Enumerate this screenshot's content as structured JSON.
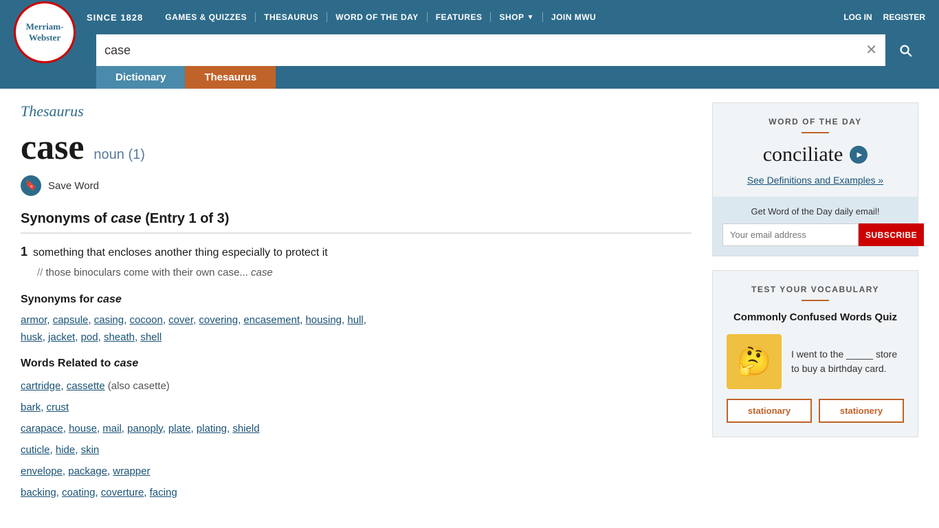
{
  "site": {
    "title": "Merriam-Webster",
    "since": "SINCE 1828",
    "logo_line1": "Merriam-",
    "logo_line2": "Webster"
  },
  "nav": {
    "items": [
      {
        "label": "GAMES & QUIZZES",
        "id": "games-quizzes"
      },
      {
        "label": "THESAURUS",
        "id": "thesaurus"
      },
      {
        "label": "WORD OF THE DAY",
        "id": "word-of-the-day"
      },
      {
        "label": "FEATURES",
        "id": "features"
      },
      {
        "label": "SHOP",
        "id": "shop",
        "has_dropdown": true
      },
      {
        "label": "JOIN MWU",
        "id": "join-mwu"
      }
    ],
    "auth": [
      {
        "label": "LOG IN",
        "id": "login"
      },
      {
        "label": "REGISTER",
        "id": "register"
      }
    ]
  },
  "search": {
    "value": "case",
    "placeholder": "Search"
  },
  "tabs": [
    {
      "label": "Dictionary",
      "id": "dictionary",
      "active": false
    },
    {
      "label": "Thesaurus",
      "id": "thesaurus",
      "active": true
    }
  ],
  "page": {
    "section_label": "Thesaurus",
    "word": "case",
    "pos": "noun (1)",
    "save_word_label": "Save Word",
    "entry_heading": "Synonyms of case (Entry 1 of 3)",
    "definition_number": "1",
    "definition_text": "something that encloses another thing especially to protect it",
    "example": "those binoculars come with their own case",
    "synonyms_heading_prefix": "Synonyms for ",
    "synonyms_heading_word": "case",
    "synonyms": [
      "armor",
      "capsule",
      "casing",
      "cocoon",
      "cover",
      "covering",
      "encasement",
      "housing",
      "hull",
      "husk",
      "jacket",
      "pod",
      "sheath",
      "shell"
    ],
    "related_heading_prefix": "Words Related to ",
    "related_heading_word": "case",
    "related_groups": [
      {
        "words": [
          "cartridge",
          "cassette"
        ],
        "note": "(also casette)"
      },
      {
        "words": [
          "bark",
          "crust"
        ],
        "note": null
      },
      {
        "words": [
          "carapace",
          "house",
          "mail",
          "panoply",
          "plate",
          "plating",
          "shield"
        ],
        "note": null
      },
      {
        "words": [
          "cuticle",
          "hide",
          "skin"
        ],
        "note": null
      },
      {
        "words": [
          "envelope",
          "package",
          "wrapper"
        ],
        "note": null
      },
      {
        "words": [
          "backing",
          "coating",
          "coverture",
          "facing"
        ],
        "note": null
      }
    ]
  },
  "sidebar": {
    "wod": {
      "section_label": "WORD OF THE DAY",
      "word": "conciliate",
      "see_link": "See Definitions and Examples »",
      "email_label": "Get Word of the Day daily email!",
      "email_placeholder": "Your email address",
      "subscribe_btn": "SUBSCRIBE"
    },
    "quiz": {
      "section_label": "TEST YOUR VOCABULARY",
      "quiz_title": "Commonly Confused Words Quiz",
      "question": "I went to the _____ store to buy a birthday card.",
      "emoji": "🤔",
      "options": [
        {
          "label": "stationary",
          "id": "stationary"
        },
        {
          "label": "stationery",
          "id": "stationery"
        }
      ]
    }
  }
}
